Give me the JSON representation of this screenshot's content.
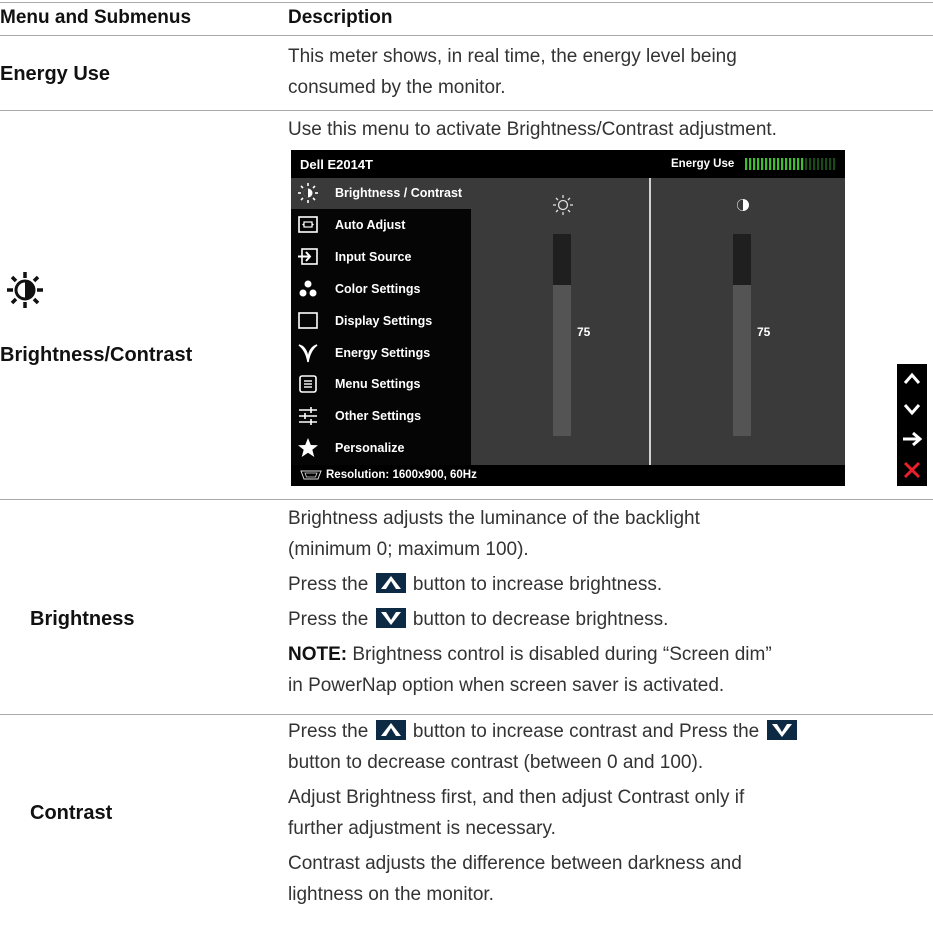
{
  "table": {
    "col1_header": "Menu and Submenus",
    "col2_header": "Description"
  },
  "energy_use": {
    "label": "Energy Use",
    "desc_line1": "This meter shows, in real time, the energy level being",
    "desc_line2": "consumed by the monitor."
  },
  "brightness_contrast": {
    "label": "Brightness/Contrast",
    "icon": "brightness-contrast-icon",
    "desc": "Use this menu to activate Brightness/Contrast adjustment."
  },
  "osd": {
    "model": "Dell E2014T",
    "energy_label": "Energy Use",
    "energy_bars_total": 23,
    "energy_bars_on": 15,
    "menu": [
      {
        "label": "Brightness / Contrast",
        "icon": "sun-icon",
        "selected": true
      },
      {
        "label": "Auto Adjust",
        "icon": "auto-adjust-icon"
      },
      {
        "label": "Input Source",
        "icon": "input-source-icon"
      },
      {
        "label": "Color Settings",
        "icon": "color-settings-icon"
      },
      {
        "label": "Display Settings",
        "icon": "display-settings-icon"
      },
      {
        "label": "Energy Settings",
        "icon": "energy-settings-icon"
      },
      {
        "label": "Menu Settings",
        "icon": "menu-settings-icon"
      },
      {
        "label": "Other Settings",
        "icon": "other-settings-icon"
      },
      {
        "label": "Personalize",
        "icon": "star-icon"
      }
    ],
    "brightness_value": "75",
    "contrast_value": "75",
    "brightness_level": 75,
    "contrast_level": 75,
    "resolution": "Resolution: 1600x900, 60Hz",
    "nav_buttons": [
      "up-arrow-icon",
      "down-arrow-icon",
      "right-arrow-icon",
      "close-icon"
    ]
  },
  "brightness": {
    "label": "Brightness",
    "p1_line1": "Brightness adjusts the luminance of the backlight",
    "p1_line2": "(minimum 0; maximum 100).",
    "p2_pre": "Press the",
    "p2_post": "button to increase brightness.",
    "p3_pre": "Press the",
    "p3_post": "button to decrease brightness.",
    "note_label": "NOTE:",
    "note_line1": " Brightness control is disabled during “Screen dim”",
    "note_line2": "in PowerNap option when screen saver is activated."
  },
  "contrast": {
    "label": "Contrast",
    "p1_pre": "Press the",
    "p1_mid": "button to increase contrast and Press the",
    "p1_line2": "button to decrease contrast (between 0 and 100).",
    "p2_line1": "Adjust Brightness first, and then adjust Contrast only if",
    "p2_line2": "further adjustment is necessary.",
    "p3_line1": "Contrast adjusts the difference between darkness and",
    "p3_line2": "lightness on the monitor."
  }
}
